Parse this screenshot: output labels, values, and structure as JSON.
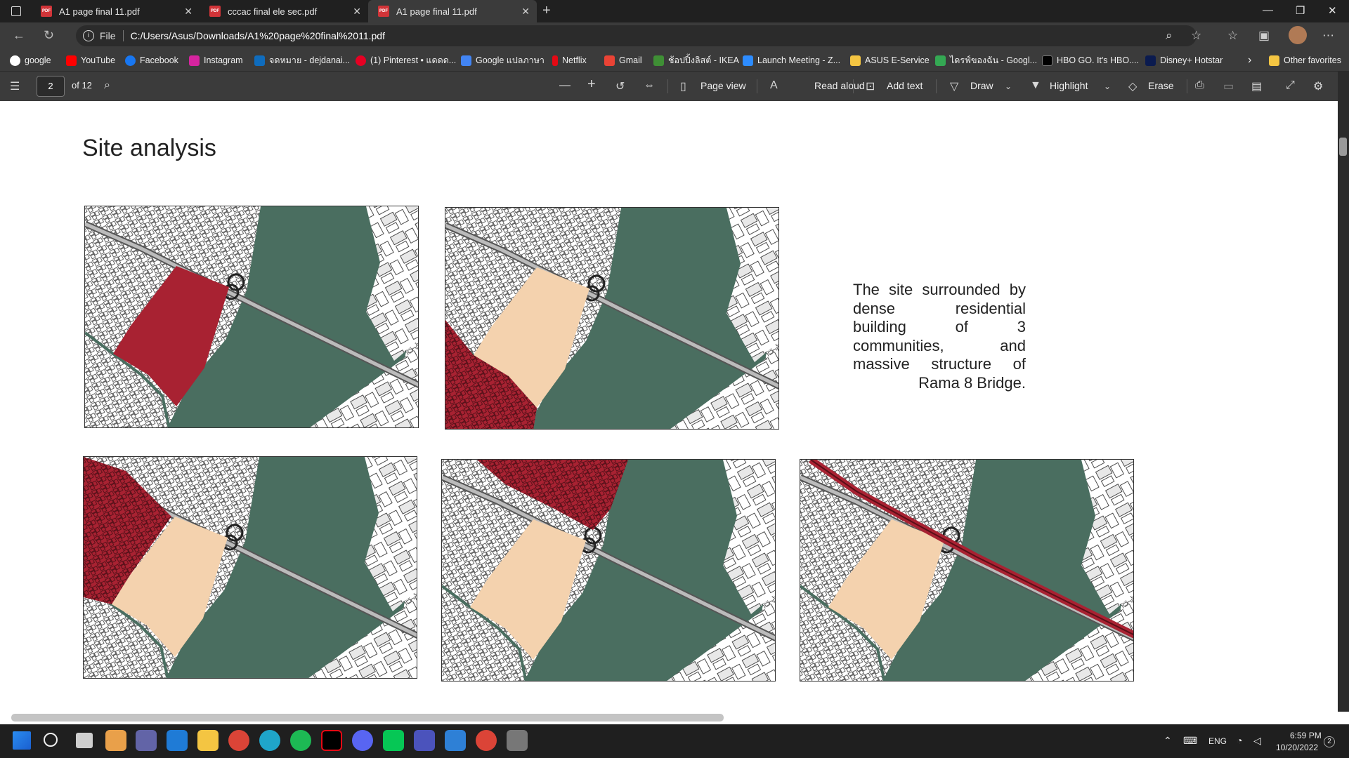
{
  "tabs": [
    {
      "label": "A1 page final 11.pdf"
    },
    {
      "label": "cccac final ele sec.pdf"
    },
    {
      "label": "A1 page final 11.pdf"
    }
  ],
  "address": {
    "file_label": "File",
    "url": "C:/Users/Asus/Downloads/A1%20page%20final%2011.pdf"
  },
  "bookmarks": [
    {
      "label": "google",
      "color": "#ffffff"
    },
    {
      "label": "YouTube",
      "color": "#ff0000"
    },
    {
      "label": "Facebook",
      "color": "#1877f2"
    },
    {
      "label": "Instagram",
      "color": "#d6249f"
    },
    {
      "label": "จดหมาย - dejdanai...",
      "color": "#0f6cbd"
    },
    {
      "label": "(1) Pinterest • แดดด...",
      "color": "#e60023"
    },
    {
      "label": "Google แปลภาษา",
      "color": "#4285f4"
    },
    {
      "label": "Netflix",
      "color": "#e50914"
    },
    {
      "label": "Gmail",
      "color": "#ea4335"
    },
    {
      "label": "ช้อปปิ้งลิสต์ - IKEA",
      "color": "#0058a3"
    },
    {
      "label": "Launch Meeting - Z...",
      "color": "#2d8cff"
    },
    {
      "label": "ASUS E-Service",
      "color": "#f4c542"
    },
    {
      "label": "ไดรฟ์ของฉัน - Googl...",
      "color": "#34a853"
    },
    {
      "label": "HBO GO. It's HBO....",
      "color": "#000000"
    },
    {
      "label": "Disney+ Hotstar",
      "color": "#0b1b4f"
    }
  ],
  "other_favorites": "Other favorites",
  "pdf_toolbar": {
    "page": "2",
    "of_pages": "of 12",
    "page_view": "Page view",
    "read_aloud": "Read aloud",
    "add_text": "Add text",
    "draw": "Draw",
    "highlight": "Highlight",
    "erase": "Erase"
  },
  "document": {
    "title": "Site analysis",
    "description": "The site surrounded by dense residential building of 3 communities, and massive structure of Rama 8 Bridge."
  },
  "colors": {
    "river": "#4a6e60",
    "site_red": "#a82232",
    "site_beige": "#f4d2ae",
    "highlight_red": "#a82232"
  },
  "maps": [
    {
      "variant": "site"
    },
    {
      "variant": "community-1"
    },
    {
      "variant": "community-2"
    },
    {
      "variant": "community-3"
    },
    {
      "variant": "bridge"
    }
  ],
  "taskbar": {
    "language": "ENG",
    "time": "6:59 PM",
    "date": "10/20/2022",
    "notifications": "2"
  }
}
